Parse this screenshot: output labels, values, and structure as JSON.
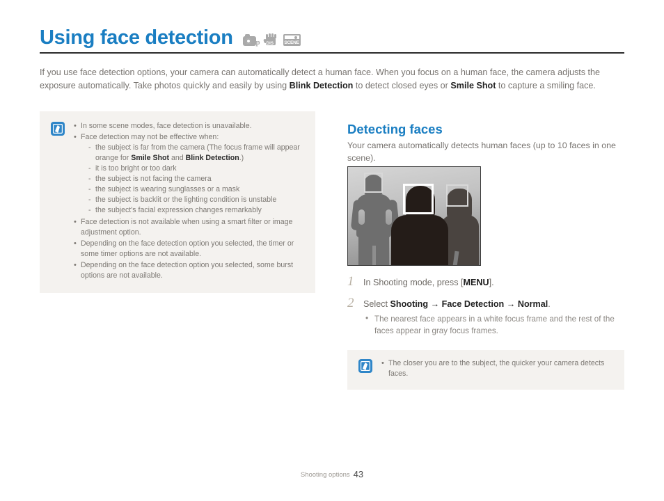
{
  "header": {
    "title": "Using face detection",
    "mode_icons": [
      {
        "name": "program-mode-icon",
        "label": "p"
      },
      {
        "name": "dis-mode-icon",
        "label": "DIS"
      },
      {
        "name": "scene-mode-icon",
        "label": "SCENE"
      }
    ]
  },
  "intro": {
    "part1": "If you use face detection options, your camera can automatically detect a human face. When you focus on a human face, the camera adjusts the exposure automatically. Take photos quickly and easily by using ",
    "bold1": "Blink Detection",
    "part2": " to detect closed eyes or ",
    "bold2": "Smile Shot",
    "part3": " to capture a smiling face."
  },
  "note_left": {
    "icon": "note-quill-icon",
    "items": [
      "In some scene modes, face detection is unavailable.",
      "Face detection may not be effective when:"
    ],
    "sub_items": [
      {
        "text_pre": "the subject is far from the camera (The focus frame will appear orange for ",
        "bold1": "Smile Shot",
        "text_mid": " and ",
        "bold2": "Blink Detection",
        "text_post": ".)"
      },
      {
        "text_pre": "it is too bright or too dark"
      },
      {
        "text_pre": "the subject is not facing the camera"
      },
      {
        "text_pre": "the subject is wearing sunglasses or a mask"
      },
      {
        "text_pre": "the subject is backlit or the lighting condition is unstable"
      },
      {
        "text_pre": "the subject's facial expression changes remarkably"
      }
    ],
    "items_after": [
      "Face detection is not available when using a smart filter or image adjustment option.",
      "Depending on the face detection option you selected, the timer or some timer options are not available.",
      "Depending on the face detection option you selected, some burst options are not available."
    ]
  },
  "right_column": {
    "sub_title": "Detecting faces",
    "sub_intro": "Your camera automatically detects human faces (up to 10 faces in one scene).",
    "illustration": {
      "name": "face-detection-illustration",
      "focus_frames": [
        {
          "name": "focus-frame-left",
          "style": "gray"
        },
        {
          "name": "focus-frame-center",
          "style": "white"
        },
        {
          "name": "focus-frame-right",
          "style": "gray"
        }
      ]
    },
    "steps": [
      {
        "number": "1",
        "text_pre": "In Shooting mode, press [",
        "key": "MENU",
        "text_post": "]."
      },
      {
        "number": "2",
        "text_pre": "Select ",
        "bold1": "Shooting",
        "arrow1": " → ",
        "bold2": "Face Detection",
        "arrow2": " → ",
        "bold3": "Normal",
        "text_post": ".",
        "sub": "The nearest face appears in a white focus frame and the rest of the faces appear in gray focus frames."
      }
    ]
  },
  "note_right": {
    "icon": "note-quill-icon",
    "items": [
      "The closer you are to the subject, the quicker your camera detects faces."
    ]
  },
  "footer": {
    "section": "Shooting options",
    "page_number": "43"
  },
  "colors": {
    "accent_blue": "#1a7ec2",
    "note_bg": "#f4f2ef",
    "body_text": "#77736f",
    "step_number": "#b9b1a4"
  }
}
